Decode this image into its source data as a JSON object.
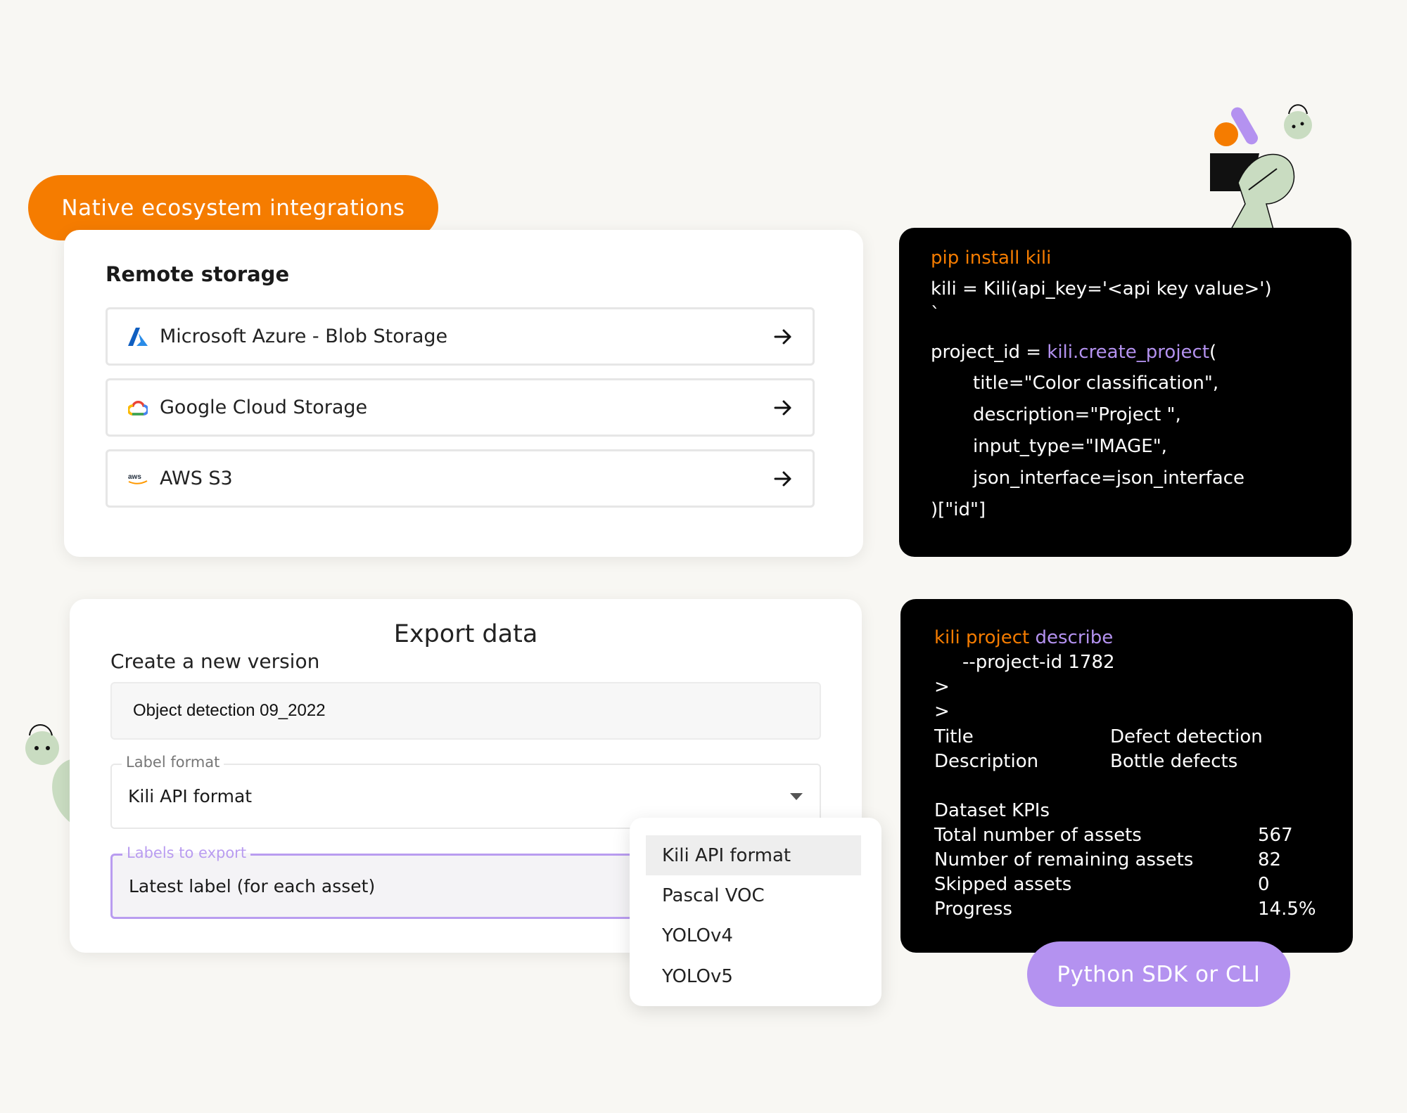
{
  "badges": {
    "integrations": "Native ecosystem integrations",
    "sdk": "Python SDK or CLI"
  },
  "storage": {
    "title": "Remote storage",
    "items": [
      {
        "label": "Microsoft Azure - Blob Storage",
        "icon": "azure-icon"
      },
      {
        "label": "Google Cloud Storage",
        "icon": "google-cloud-icon"
      },
      {
        "label": "AWS S3",
        "icon": "aws-icon"
      }
    ]
  },
  "export": {
    "title": "Export data",
    "subtitle": "Create a new version",
    "version_value": "Object detection 09_2022",
    "label_format": {
      "label": "Label format",
      "value": "Kili API format"
    },
    "labels_to_export": {
      "label": "Labels to export",
      "value": "Latest label (for each asset)"
    },
    "dropdown_options": [
      "Kili API format",
      "Pascal VOC",
      "YOLOv4",
      "YOLOv5"
    ],
    "selected_option": "Kili API format"
  },
  "code": {
    "line1": "pip install kili",
    "line2": "kili = Kili(api_key='<api key value>')",
    "line3": "`",
    "line4_a": "project_id = ",
    "line4_b": "kili.create_project",
    "line4_c": "(",
    "line5": "title=\"Color classification\",",
    "line6": "description=\"Project \",",
    "line7": "input_type=\"IMAGE\",",
    "line8": "json_interface=json_interface",
    "line9": ")[\"id\"]"
  },
  "cli": {
    "cmd_a": "kili project ",
    "cmd_b": "describe",
    "arg": "--project-id 1782",
    "prompt1": ">",
    "prompt2": ">",
    "rows": [
      {
        "key": "Title",
        "value": "Defect detection"
      },
      {
        "key": "Description",
        "value": "Bottle defects"
      }
    ],
    "kpi_title": "Dataset KPIs",
    "kpis": [
      {
        "key": "Total number of assets",
        "value": "567"
      },
      {
        "key": "Number of remaining assets",
        "value": "82"
      },
      {
        "key": "Skipped assets",
        "value": "0"
      },
      {
        "key": "Progress",
        "value": "14.5%"
      }
    ]
  },
  "colors": {
    "orange": "#f57c00",
    "purple": "#b492f0",
    "mint": "#c9dcc1"
  }
}
